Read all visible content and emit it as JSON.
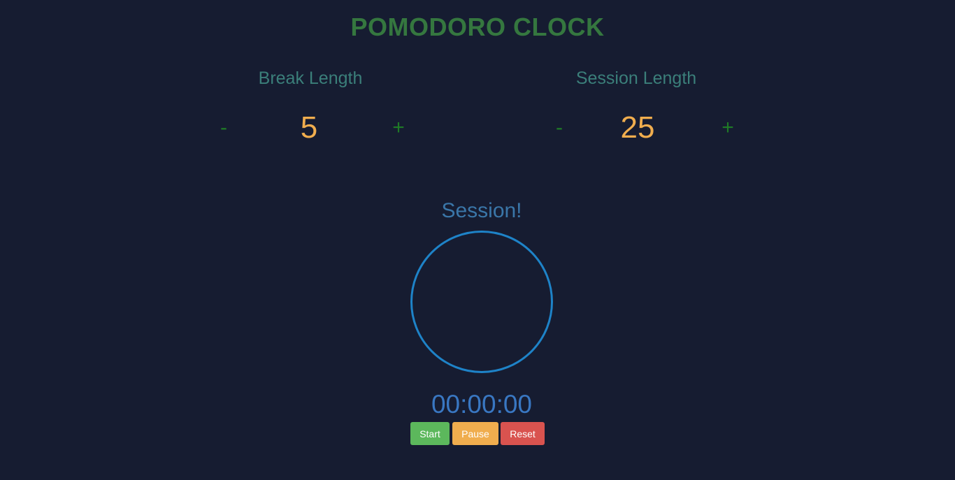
{
  "app": {
    "title": "POMODORO CLOCK"
  },
  "break": {
    "label": "Break Length",
    "decrement": "-",
    "increment": "+",
    "value": "5"
  },
  "session": {
    "label": "Session Length",
    "decrement": "-",
    "increment": "+",
    "value": "25"
  },
  "timer": {
    "mode": "Session!",
    "time": "00:00:00"
  },
  "controls": {
    "start_label": "Start",
    "pause_label": "Pause",
    "reset_label": "Reset"
  },
  "colors": {
    "background": "#161c31",
    "title": "#35773f",
    "label": "#3b7f7a",
    "adjust": "#1f7a26",
    "value": "#f0ad4e",
    "ring": "#1e83c8",
    "start": "#5cb85c",
    "pause": "#f0ad4e",
    "reset": "#d9534f"
  }
}
